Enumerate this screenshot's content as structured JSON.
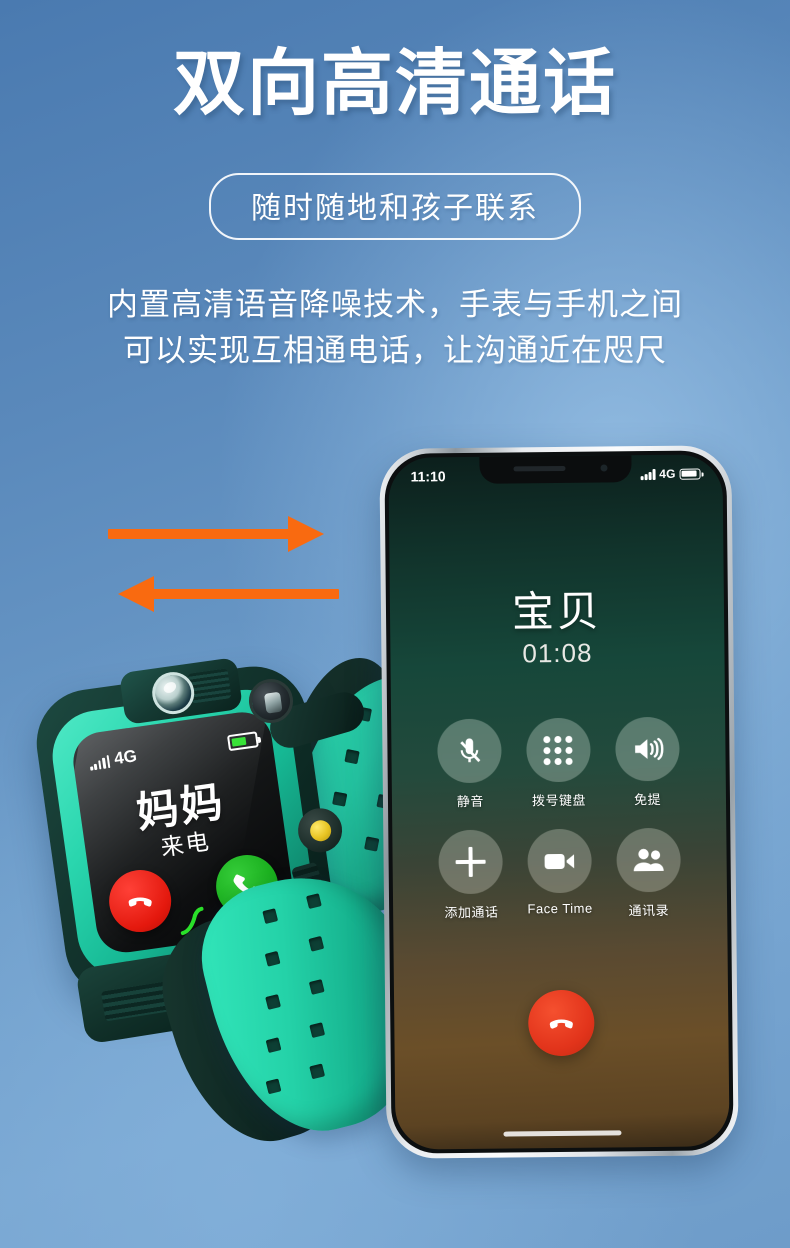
{
  "header": {
    "title": "双向高清通话",
    "subtitle_pill": "随时随地和孩子联系",
    "body_line1": "内置高清语音降噪技术，手表与手机之间",
    "body_line2": "可以实现互相通电话，让沟通近在咫尺"
  },
  "colors": {
    "background_top": "#4a7ab0",
    "background_bottom": "#6e9cc9",
    "arrow": "#f96a10",
    "watch_bezel": "#2ad6ae",
    "watch_strap": "#2ad3ab",
    "accept_green": "#18ad1c",
    "decline_red": "#e4170c",
    "title_text": "#ffffff"
  },
  "arrows": {
    "top_arrow_direction": "right",
    "bottom_arrow_direction": "left",
    "top_icon": "arrow-right-icon",
    "bottom_icon": "arrow-left-icon"
  },
  "phone": {
    "statusbar": {
      "time": "11:10",
      "network": "4G",
      "signal_icon": "signal-bars-icon",
      "battery_icon": "battery-icon"
    },
    "call": {
      "caller_name": "宝贝",
      "duration": "01:08"
    },
    "controls": [
      {
        "label": "静音",
        "icon": "mic-muted-icon"
      },
      {
        "label": "拨号键盘",
        "icon": "keypad-icon"
      },
      {
        "label": "免提",
        "icon": "speaker-icon"
      },
      {
        "label": "添加通话",
        "icon": "plus-icon"
      },
      {
        "label": "Face Time",
        "icon": "video-camera-icon"
      },
      {
        "label": "通讯录",
        "icon": "contacts-icon"
      }
    ],
    "end_call": {
      "icon": "end-call-icon"
    },
    "home_indicator": "home-indicator"
  },
  "watch": {
    "statusbar": {
      "network": "4G",
      "signal_icon": "signal-bars-icon",
      "battery_icon": "battery-icon"
    },
    "call": {
      "caller_name": "妈妈",
      "state_label": "来电"
    },
    "buttons": [
      {
        "name": "decline",
        "icon": "end-call-icon"
      },
      {
        "name": "accept",
        "icon": "phone-handset-icon"
      }
    ],
    "hardware": {
      "camera": "camera-lens-icon",
      "side_button": "yellow-side-button",
      "crown": "crown-dial"
    }
  }
}
